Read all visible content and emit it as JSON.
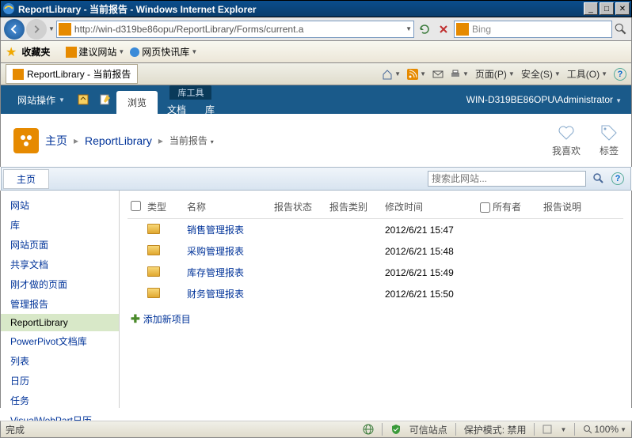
{
  "titlebar": {
    "title": "ReportLibrary - 当前报告 - Windows Internet Explorer"
  },
  "navbar": {
    "url": "http://win-d319be86opu/ReportLibrary/Forms/current.a",
    "search_engine": "Bing"
  },
  "favbar": {
    "favorites": "收藏夹",
    "suggested": "建议网站",
    "quickinfo": "网页快讯库"
  },
  "ietab": {
    "tab_title": "ReportLibrary - 当前报告",
    "home": "",
    "page": "页面(P)",
    "safety": "安全(S)",
    "tools": "工具(O)"
  },
  "ribbon": {
    "site_actions": "网站操作",
    "browse": "浏览",
    "lib_tools": "库工具",
    "documents": "文档",
    "library": "库",
    "user": "WIN-D319BE86OPU\\Administrator"
  },
  "breadcrumb": {
    "home": "主页",
    "library": "ReportLibrary",
    "current": "当前报告",
    "like": "我喜欢",
    "tags": "标签"
  },
  "topnav": {
    "home": "主页",
    "search_placeholder": "搜索此网站..."
  },
  "quicklaunch": {
    "items": [
      {
        "label": "网站"
      },
      {
        "label": "库"
      },
      {
        "label": "网站页面"
      },
      {
        "label": "共享文档"
      },
      {
        "label": "刚才做的页面"
      },
      {
        "label": "管理报告"
      },
      {
        "label": "ReportLibrary",
        "active": true
      },
      {
        "label": "PowerPivot文档库"
      },
      {
        "label": "列表"
      },
      {
        "label": "日历"
      },
      {
        "label": "任务"
      },
      {
        "label": "VisualWebPart日历"
      }
    ]
  },
  "table": {
    "headers": {
      "type": "类型",
      "name": "名称",
      "status": "报告状态",
      "category": "报告类别",
      "modified": "修改时间",
      "owner": "所有者",
      "desc": "报告说明"
    },
    "rows": [
      {
        "name": "销售管理报表",
        "modified": "2012/6/21 15:47"
      },
      {
        "name": "采购管理报表",
        "modified": "2012/6/21 15:48"
      },
      {
        "name": "库存管理报表",
        "modified": "2012/6/21 15:49"
      },
      {
        "name": "财务管理报表",
        "modified": "2012/6/21 15:50"
      }
    ],
    "add_new": "添加新项目"
  },
  "statusbar": {
    "done": "完成",
    "trusted": "可信站点",
    "protected": "保护模式: 禁用",
    "zoom": "100%"
  }
}
